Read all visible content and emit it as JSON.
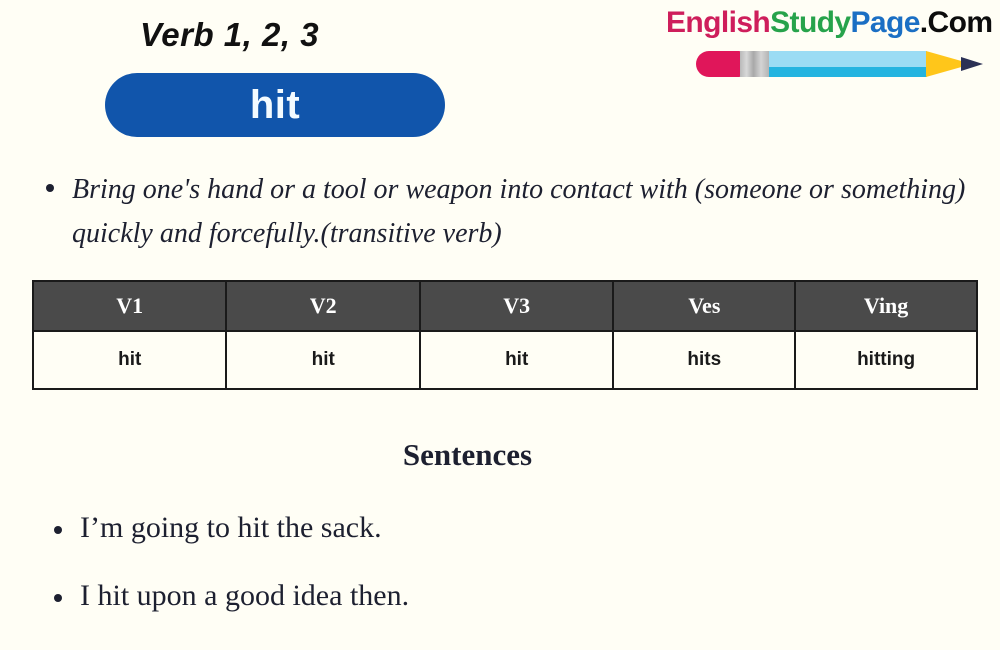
{
  "header": {
    "verb_heading": "Verb 1, 2, 3",
    "word": "hit",
    "pill_color": "#1155ab",
    "pill_text_color": "#f4fbff"
  },
  "logo": {
    "segments": [
      {
        "text": "English",
        "color": "#ce1e5b"
      },
      {
        "text": "Study",
        "color": "#27a34b"
      },
      {
        "text": "Page",
        "color": "#1b6fc4"
      },
      {
        "text": ".Com",
        "color": "#0c0c0c"
      }
    ],
    "pencil": {
      "eraser_color": "#e0165a",
      "ferrule_color": "#c0c0c0",
      "body_color": "#9bdcf4",
      "body_stripe_color": "#24b4e0",
      "tip_color": "#ffc61a",
      "lead_color": "#2b3155"
    }
  },
  "definition": {
    "text": "Bring one's hand or a tool or weapon into contact with (someone or something) quickly and forcefully.(transitive verb)"
  },
  "table": {
    "headers": [
      "V1",
      "V2",
      "V3",
      "Ves",
      "Ving"
    ],
    "rows": [
      [
        "hit",
        "hit",
        "hit",
        "hits",
        "hitting"
      ]
    ],
    "header_bg": "#4a4a4a",
    "header_color": "#ffffff",
    "cell_bg": "#fffef5",
    "border_color": "#1a1a1a"
  },
  "sentences": {
    "heading": "Sentences",
    "items": [
      "I’m going to hit the sack.",
      "I hit upon a good idea then."
    ]
  },
  "page": {
    "background": "#fffef5"
  }
}
